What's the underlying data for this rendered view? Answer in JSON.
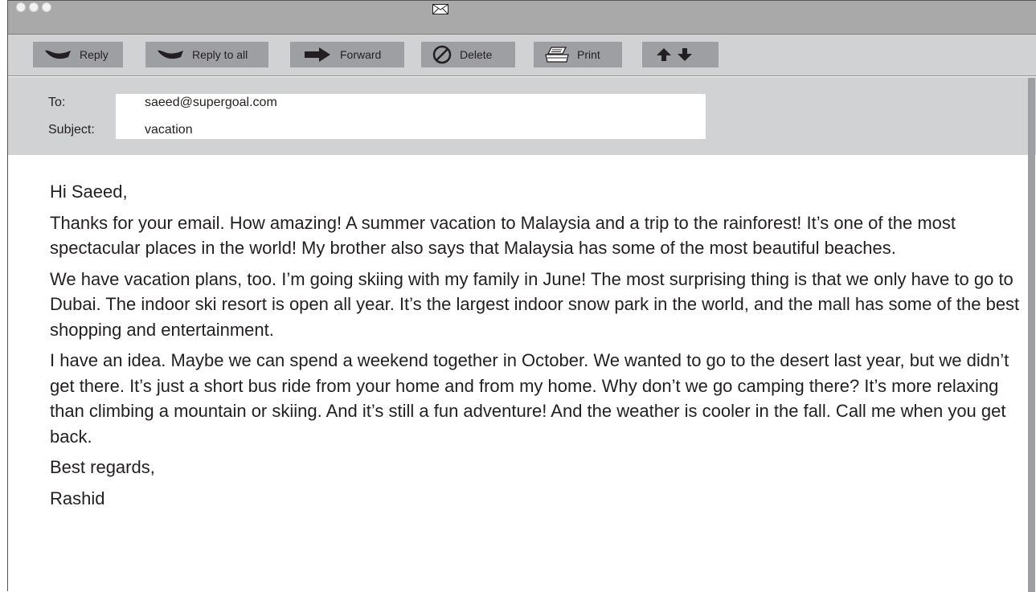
{
  "toolbar": {
    "reply": "Reply",
    "reply_all": "Reply to all",
    "forward": "Forward",
    "delete": "Delete",
    "print": "Print"
  },
  "header": {
    "to_label": "To:",
    "to_value": "saeed@supergoal.com",
    "subject_label": "Subject:",
    "subject_value": "vacation"
  },
  "message": {
    "greeting": "Hi Saeed,",
    "paragraphs": [
      "Thanks for your email. How amazing! A summer vacation to Malaysia and a trip to the rainforest! It’s one of the most spectacular places in the world! My brother also says that Malaysia has some of the most beautiful beaches.",
      "We have vacation plans, too. I’m going skiing with my family in June! The most surprising thing is that we only have to go to Dubai. The indoor ski resort is open all year. It’s the largest indoor snow park in the world, and the mall has some of the best shopping and entertainment.",
      "I have an idea. Maybe we can spend a weekend together in October. We wanted to go to the desert last year, but we didn’t get there. It’s just a short bus ride from your home and from my home. Why don’t we go camping there? It’s more relaxing than climbing a mountain or skiing. And it’s still a fun adventure! And the weather is cooler in the fall. Call me when you get back."
    ],
    "closing": "Best regards,",
    "signature": "Rashid"
  },
  "icons": {
    "envelope": "envelope-icon",
    "reply": "reply-arrow-icon",
    "reply_all": "reply-all-arrow-icon",
    "forward": "forward-arrow-icon",
    "delete": "prohibited-icon",
    "print": "printer-icon",
    "prev": "arrow-up-icon",
    "next": "arrow-down-icon"
  }
}
